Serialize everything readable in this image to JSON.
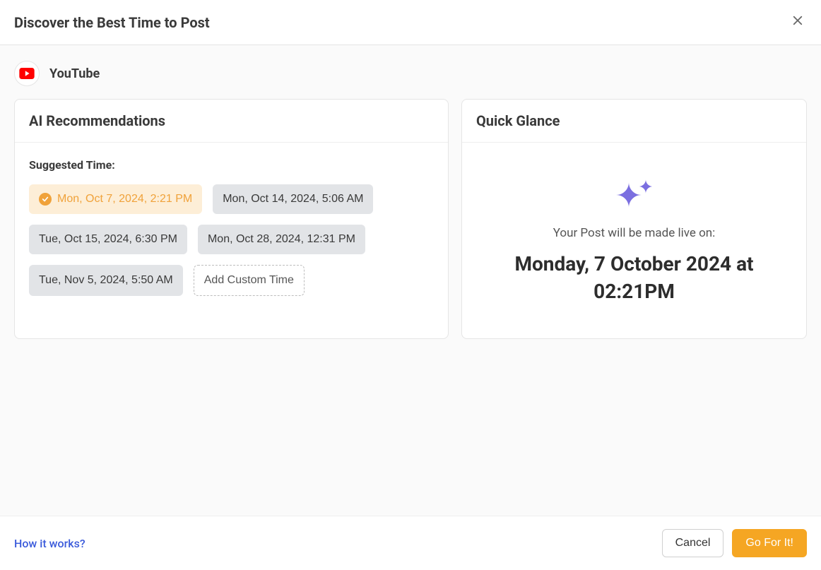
{
  "header": {
    "title": "Discover the Best Time to Post"
  },
  "platform": {
    "name": "YouTube"
  },
  "recommendations": {
    "panel_title": "AI Recommendations",
    "suggested_label": "Suggested Time:",
    "times": [
      {
        "label": "Mon, Oct 7, 2024, 2:21 PM",
        "selected": true
      },
      {
        "label": "Mon, Oct 14, 2024, 5:06 AM",
        "selected": false
      },
      {
        "label": "Tue, Oct 15, 2024, 6:30 PM",
        "selected": false
      },
      {
        "label": "Mon, Oct 28, 2024, 12:31 PM",
        "selected": false
      },
      {
        "label": "Tue, Nov 5, 2024, 5:50 AM",
        "selected": false
      }
    ],
    "add_custom_label": "Add Custom Time"
  },
  "glance": {
    "panel_title": "Quick Glance",
    "sparkle_color": "#7b6fe0",
    "caption": "Your Post will be made live on:",
    "scheduled_text": "Monday, 7 October 2024 at 02:21PM"
  },
  "footer": {
    "help_link": "How it works?",
    "cancel": "Cancel",
    "confirm": "Go For It!"
  }
}
